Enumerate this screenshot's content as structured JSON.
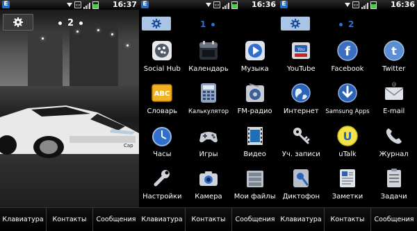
{
  "status_bar": {
    "network_badge": "E",
    "time_home": "16:37",
    "time_menu": "16:36",
    "battery_level": 0.65
  },
  "home": {
    "page_number": "2"
  },
  "menu_page1": {
    "page_number": "1",
    "apps": [
      {
        "label": "Social Hub",
        "icon": "social-hub-icon"
      },
      {
        "label": "Календарь",
        "icon": "calendar-icon"
      },
      {
        "label": "Музыка",
        "icon": "music-icon"
      },
      {
        "label": "Словарь",
        "icon": "dictionary-icon"
      },
      {
        "label": "Калькулятор",
        "icon": "calculator-icon"
      },
      {
        "label": "FM-радио",
        "icon": "fm-radio-icon"
      },
      {
        "label": "Часы",
        "icon": "clock-icon"
      },
      {
        "label": "Игры",
        "icon": "games-icon"
      },
      {
        "label": "Видео",
        "icon": "video-icon"
      },
      {
        "label": "Настройки",
        "icon": "settings-wrench-icon"
      },
      {
        "label": "Камера",
        "icon": "camera-icon"
      },
      {
        "label": "Мои файлы",
        "icon": "my-files-icon"
      }
    ]
  },
  "menu_page2": {
    "page_number": "2",
    "apps": [
      {
        "label": "YouTube",
        "icon": "youtube-icon"
      },
      {
        "label": "Facebook",
        "icon": "facebook-icon"
      },
      {
        "label": "Twitter",
        "icon": "twitter-icon"
      },
      {
        "label": "Интернет",
        "icon": "internet-globe-icon"
      },
      {
        "label": "Samsung Apps",
        "icon": "samsung-apps-icon"
      },
      {
        "label": "E-mail",
        "icon": "email-icon"
      },
      {
        "label": "Уч. записи",
        "icon": "accounts-keys-icon"
      },
      {
        "label": "uTalk",
        "icon": "utalk-icon"
      },
      {
        "label": "Журнал",
        "icon": "call-log-icon"
      },
      {
        "label": "Диктофон",
        "icon": "voice-recorder-icon"
      },
      {
        "label": "Заметки",
        "icon": "notes-icon"
      },
      {
        "label": "Задачи",
        "icon": "tasks-icon"
      }
    ]
  },
  "softkeys": {
    "keypad": "Клавиатура",
    "contacts": "Контакты",
    "messages": "Сообщения"
  },
  "colors": {
    "accent_blue": "#2f6fd0",
    "gear_button_bg": "#a9c4e4"
  }
}
